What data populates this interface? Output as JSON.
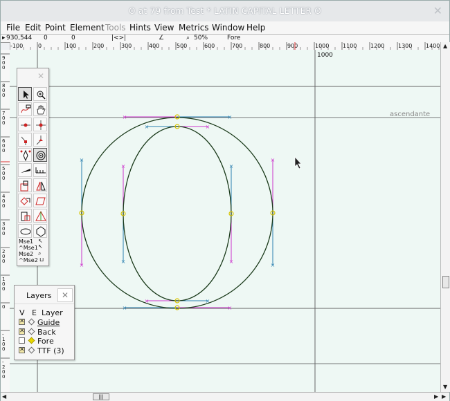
{
  "window": {
    "title": "O at 79 from Test * LATIN CAPITAL LETTER O",
    "close_glyph": "✕"
  },
  "menu": [
    "File",
    "Edit",
    "Point",
    "Element",
    "Tools",
    "Hints",
    "View",
    "Metrics",
    "Window",
    "Help"
  ],
  "infobar": {
    "coords": "930,544",
    "marker1": "0",
    "marker2": "0",
    "angle_left": "|<>|",
    "zoom": "50%",
    "layer": "Fore"
  },
  "ruler": {
    "h_ticks": [
      "-100",
      "0",
      "100",
      "200",
      "300",
      "400",
      "500",
      "600",
      "700",
      "800",
      "900",
      "1000",
      "1100",
      "1200",
      "1300",
      "1400"
    ],
    "v_ticks": [
      "900",
      "800",
      "700",
      "600",
      "500",
      "400",
      "300",
      "200",
      "100",
      "0",
      "-100",
      "-200"
    ]
  },
  "canvas": {
    "advance_label": "1000",
    "ascender_label": "ascendante"
  },
  "tools_palette": {
    "close_glyph": "✕",
    "tools": [
      "pointer",
      "magnify",
      "freehand",
      "scroll",
      "curve-point",
      "hv-curve-point",
      "corner-point",
      "tangent-point",
      "pen",
      "spiro",
      "knife",
      "ruler",
      "scale",
      "flip",
      "rotate",
      "skew",
      "3d-rotate",
      "perspective",
      "rectangle",
      "polygon",
      "ellipse",
      "star"
    ],
    "mouse_labels": [
      "Mse1",
      "^Mse1",
      "Mse2",
      "^Mse2"
    ]
  },
  "layers": {
    "title": "Layers",
    "close_glyph": "✕",
    "header_v": "V",
    "header_e": "E",
    "header_layer": "Layer",
    "items": [
      {
        "name": "Guide",
        "visible": true
      },
      {
        "name": "Back",
        "visible": true
      },
      {
        "name": "Fore",
        "visible": false
      },
      {
        "name": "TTF (3)",
        "visible": true
      }
    ]
  },
  "colors": {
    "canvas": "#eef8f4",
    "outline": "#1a3a1a",
    "handle_magenta": "#cc33cc",
    "handle_blue": "#2a7fb0",
    "point_yellow": "#d8c400"
  }
}
